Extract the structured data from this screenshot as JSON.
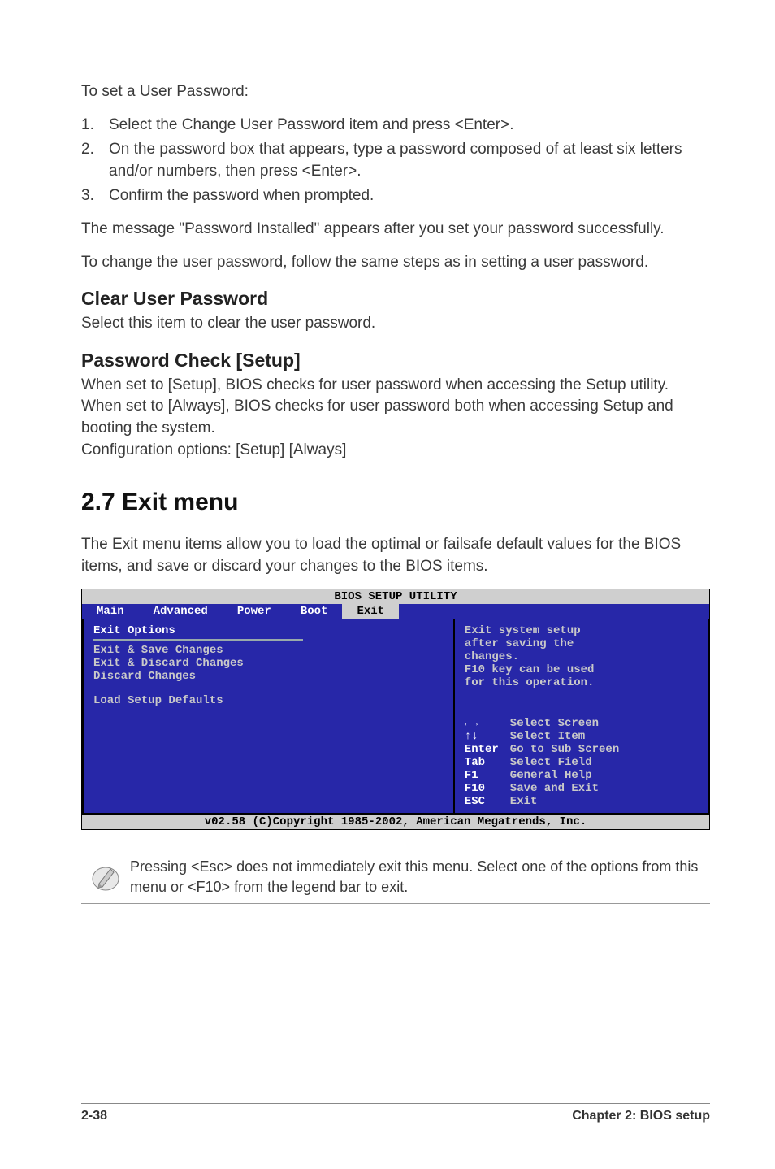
{
  "intro": "To set a User Password:",
  "steps": [
    "Select the Change User Password item and press <Enter>.",
    "On the password box that appears, type a password composed of at least six letters and/or numbers, then press <Enter>.",
    "Confirm the password when prompted."
  ],
  "after_steps_1": "The message \"Password Installed\" appears after you set your password successfully.",
  "after_steps_2": "To change the user password, follow the same steps as in setting a user password.",
  "section_clear": {
    "title": "Clear User Password",
    "body": "Select this item to clear the user password."
  },
  "section_pw": {
    "title": "Password Check [Setup]",
    "body1": "When set to [Setup], BIOS checks for user password when accessing the Setup utility. When set to [Always], BIOS checks for user password both when accessing Setup and booting the system.",
    "body2": "Configuration options: [Setup] [Always]"
  },
  "exit_menu": {
    "title": "2.7    Exit menu",
    "intro": "The Exit menu items allow you to load the optimal or failsafe default values for the BIOS items, and save or discard your changes to the BIOS items."
  },
  "bios": {
    "title": "BIOS SETUP UTILITY",
    "tabs": [
      "Main",
      "Advanced",
      "Power",
      "Boot",
      "Exit"
    ],
    "active_tab_index": 4,
    "left": {
      "header": "Exit Options",
      "items": [
        "Exit & Save Changes",
        "Exit & Discard Changes",
        "Discard Changes",
        "",
        "Load Setup Defaults"
      ]
    },
    "right_help": [
      "Exit system setup",
      "after saving the",
      "changes.",
      "F10 key can be used",
      "for this operation."
    ],
    "keys": [
      {
        "k": "←→",
        "v": "Select Screen"
      },
      {
        "k": "↑↓",
        "v": "Select Item"
      },
      {
        "k": "Enter",
        "v": "Go to Sub Screen"
      },
      {
        "k": "Tab",
        "v": "Select Field"
      },
      {
        "k": "F1",
        "v": "General Help"
      },
      {
        "k": "F10",
        "v": "Save and Exit"
      },
      {
        "k": "ESC",
        "v": "Exit"
      }
    ],
    "footer": "v02.58 (C)Copyright 1985-2002, American Megatrends, Inc."
  },
  "note": "Pressing <Esc> does not immediately exit this menu. Select one of the options from this menu or <F10> from the legend bar to exit.",
  "page_footer": {
    "left": "2-38",
    "right": "Chapter 2: BIOS setup"
  }
}
